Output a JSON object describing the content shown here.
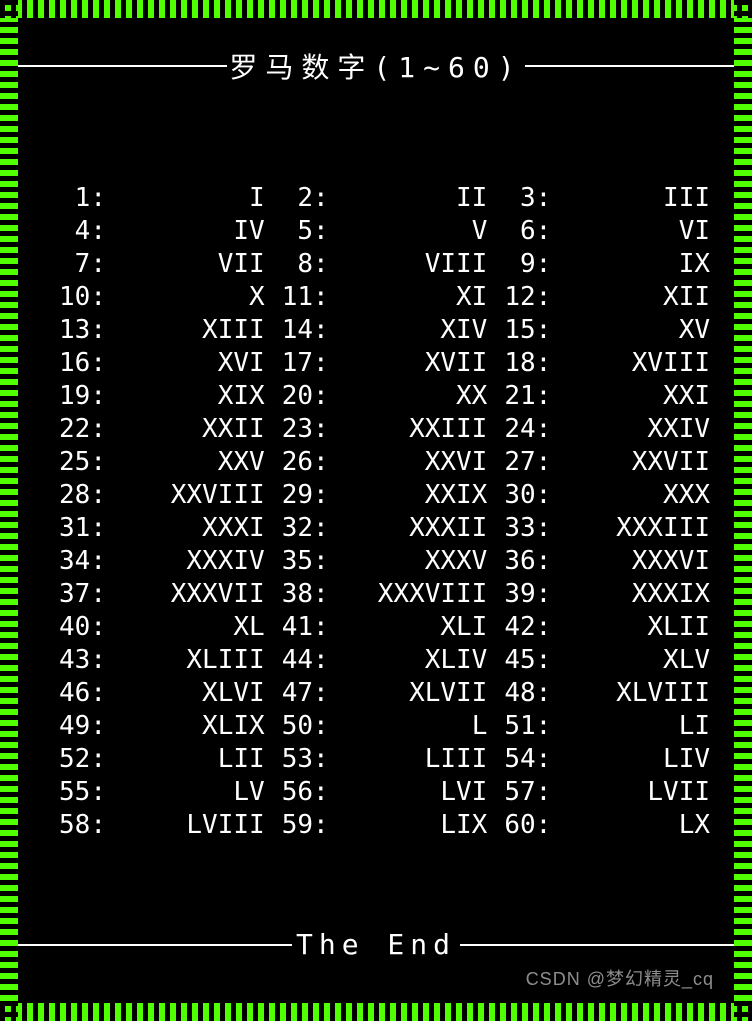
{
  "title": "罗马数字(1~60)",
  "footer": "The End",
  "watermark": "CSDN @梦幻精灵_cq",
  "chart_data": {
    "type": "table",
    "title": "罗马数字(1~60)",
    "columns": [
      "arabic",
      "roman"
    ],
    "rows": [
      [
        1,
        "I"
      ],
      [
        2,
        "II"
      ],
      [
        3,
        "III"
      ],
      [
        4,
        "IV"
      ],
      [
        5,
        "V"
      ],
      [
        6,
        "VI"
      ],
      [
        7,
        "VII"
      ],
      [
        8,
        "VIII"
      ],
      [
        9,
        "IX"
      ],
      [
        10,
        "X"
      ],
      [
        11,
        "XI"
      ],
      [
        12,
        "XII"
      ],
      [
        13,
        "XIII"
      ],
      [
        14,
        "XIV"
      ],
      [
        15,
        "XV"
      ],
      [
        16,
        "XVI"
      ],
      [
        17,
        "XVII"
      ],
      [
        18,
        "XVIII"
      ],
      [
        19,
        "XIX"
      ],
      [
        20,
        "XX"
      ],
      [
        21,
        "XXI"
      ],
      [
        22,
        "XXII"
      ],
      [
        23,
        "XXIII"
      ],
      [
        24,
        "XXIV"
      ],
      [
        25,
        "XXV"
      ],
      [
        26,
        "XXVI"
      ],
      [
        27,
        "XXVII"
      ],
      [
        28,
        "XXVIII"
      ],
      [
        29,
        "XXIX"
      ],
      [
        30,
        "XXX"
      ],
      [
        31,
        "XXXI"
      ],
      [
        32,
        "XXXII"
      ],
      [
        33,
        "XXXIII"
      ],
      [
        34,
        "XXXIV"
      ],
      [
        35,
        "XXXV"
      ],
      [
        36,
        "XXXVI"
      ],
      [
        37,
        "XXXVII"
      ],
      [
        38,
        "XXXVIII"
      ],
      [
        39,
        "XXXIX"
      ],
      [
        40,
        "XL"
      ],
      [
        41,
        "XLI"
      ],
      [
        42,
        "XLII"
      ],
      [
        43,
        "XLIII"
      ],
      [
        44,
        "XLIV"
      ],
      [
        45,
        "XLV"
      ],
      [
        46,
        "XLVI"
      ],
      [
        47,
        "XLVII"
      ],
      [
        48,
        "XLVIII"
      ],
      [
        49,
        "XLIX"
      ],
      [
        50,
        "L"
      ],
      [
        51,
        "LI"
      ],
      [
        52,
        "LII"
      ],
      [
        53,
        "LIII"
      ],
      [
        54,
        "LIV"
      ],
      [
        55,
        "LV"
      ],
      [
        56,
        "LVI"
      ],
      [
        57,
        "LVII"
      ],
      [
        58,
        "LVIII"
      ],
      [
        59,
        "LIX"
      ],
      [
        60,
        "LX"
      ]
    ]
  }
}
